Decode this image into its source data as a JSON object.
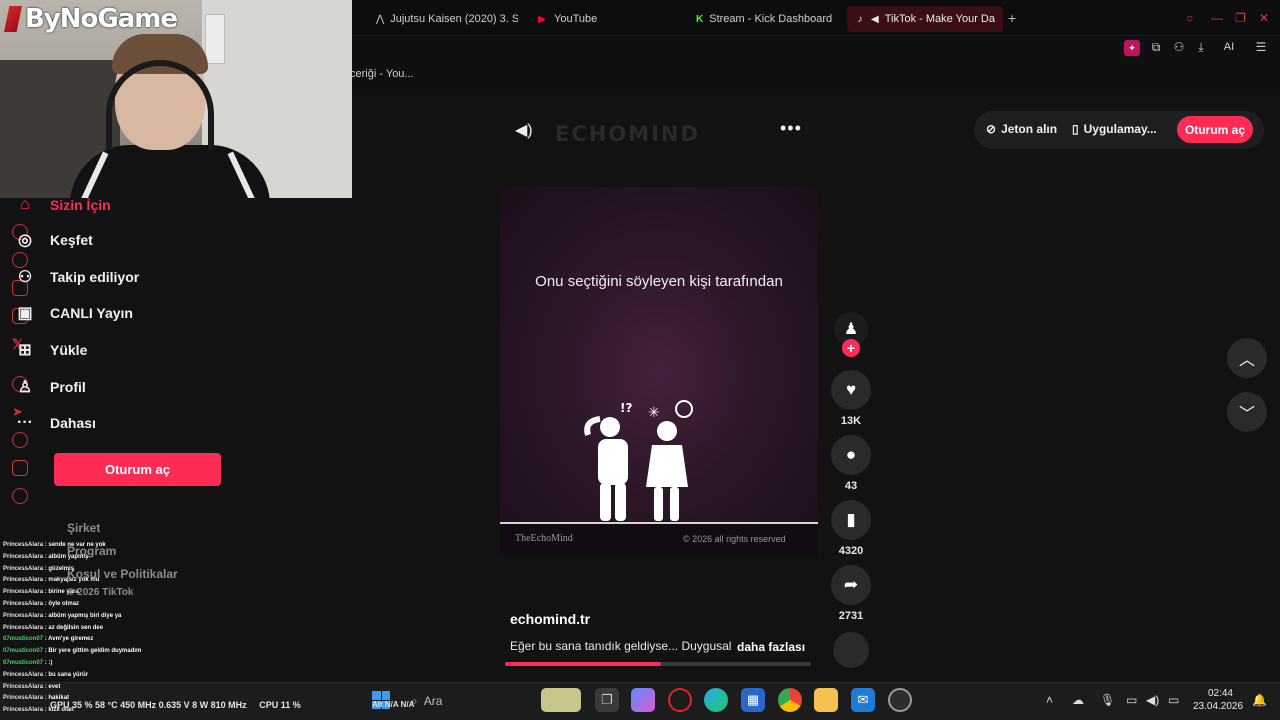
{
  "browser": {
    "tabs": [
      {
        "label": "Jujutsu Kaisen (2020) 3. S",
        "icon": "anime-icon"
      },
      {
        "label": "YouTube",
        "icon": "youtube-icon"
      },
      {
        "label": "Stream - Kick Dashboard",
        "icon": "kick-icon"
      },
      {
        "label": "TikTok - Make Your Da",
        "icon": "tiktok-icon"
      }
    ],
    "new_tab": "+",
    "address_partial": "ceriği - You...",
    "ai_label": "AI",
    "accent": "#d83a4a"
  },
  "overlay": {
    "logo_text": "ByNoGame"
  },
  "sidebar": {
    "items": [
      {
        "label": "Sizin İçin",
        "icon": "home-icon"
      },
      {
        "label": "Keşfet",
        "icon": "compass-icon"
      },
      {
        "label": "Takip ediliyor",
        "icon": "following-icon"
      },
      {
        "label": "CANLI Yayın",
        "icon": "live-icon"
      },
      {
        "label": "Yükle",
        "icon": "upload-icon"
      },
      {
        "label": "Profil",
        "icon": "profile-icon"
      },
      {
        "label": "Dahası",
        "icon": "more-icon"
      }
    ],
    "login_label": "Oturum aç",
    "footer": [
      "Şirket",
      "Program",
      "Koşul ve Politikalar",
      "© 2026 TikTok"
    ]
  },
  "chat": [
    {
      "user": "PrincessAlara",
      "msg": "sende ne var ne yok"
    },
    {
      "user": "PrincessAlara",
      "msg": "albüm yapmış"
    },
    {
      "user": "PrincessAlara",
      "msg": "güzelmiş"
    },
    {
      "user": "PrincessAlara",
      "msg": "makyajsız yok mu"
    },
    {
      "user": "PrincessAlara",
      "msg": "birine yara"
    },
    {
      "user": "PrincessAlara",
      "msg": "öyle olmaz"
    },
    {
      "user": "PrincessAlara",
      "msg": "albüm yapmış biri diye ya"
    },
    {
      "user": "PrincessAlara",
      "msg": "az değilsin sen dee"
    },
    {
      "user": "07musticon07",
      "msg": "Avm'ye giremez"
    },
    {
      "user": "07musticon07",
      "msg": "Bir yere gittim geldim duymadım"
    },
    {
      "user": "07musticon07",
      "msg": ":)"
    },
    {
      "user": "PrincessAlara",
      "msg": "bu sana yürür"
    },
    {
      "user": "PrincessAlara",
      "msg": "evet"
    },
    {
      "user": "PrincessAlara",
      "msg": "hakikat"
    },
    {
      "user": "PrincessAlara",
      "msg": "kızıl olan"
    }
  ],
  "header": {
    "brand": "ECHOMIND",
    "get_coins": "Jeton alın",
    "get_app": "Uygulamay...",
    "login": "Oturum aç"
  },
  "video": {
    "caption": "Onu seçtiğini söyleyen kişi tarafından",
    "watermark_left": "TheEchoMind",
    "watermark_right": "© 2026 all rights reserved",
    "creator": "echomind.tr",
    "description": "Eğer bu sana tanıdık geldiyse... Duygusal",
    "more": "daha fazlası",
    "progress": 0.51,
    "figure_marks": "!?"
  },
  "actions": {
    "likes": "13K",
    "comments": "43",
    "saves": "4320",
    "shares": "2731",
    "follow": "+"
  },
  "taskbar": {
    "hw_stats": "GPU 35 % 58 °C 450 MHz 0.635 V 8 W 810 MHz",
    "cpu_stats": "CPU 11 %",
    "weather": "N/A N/A",
    "weather_prefix": "Alt",
    "search_placeholder": "Ara",
    "time": "02:44",
    "date": "23.04.2026"
  }
}
